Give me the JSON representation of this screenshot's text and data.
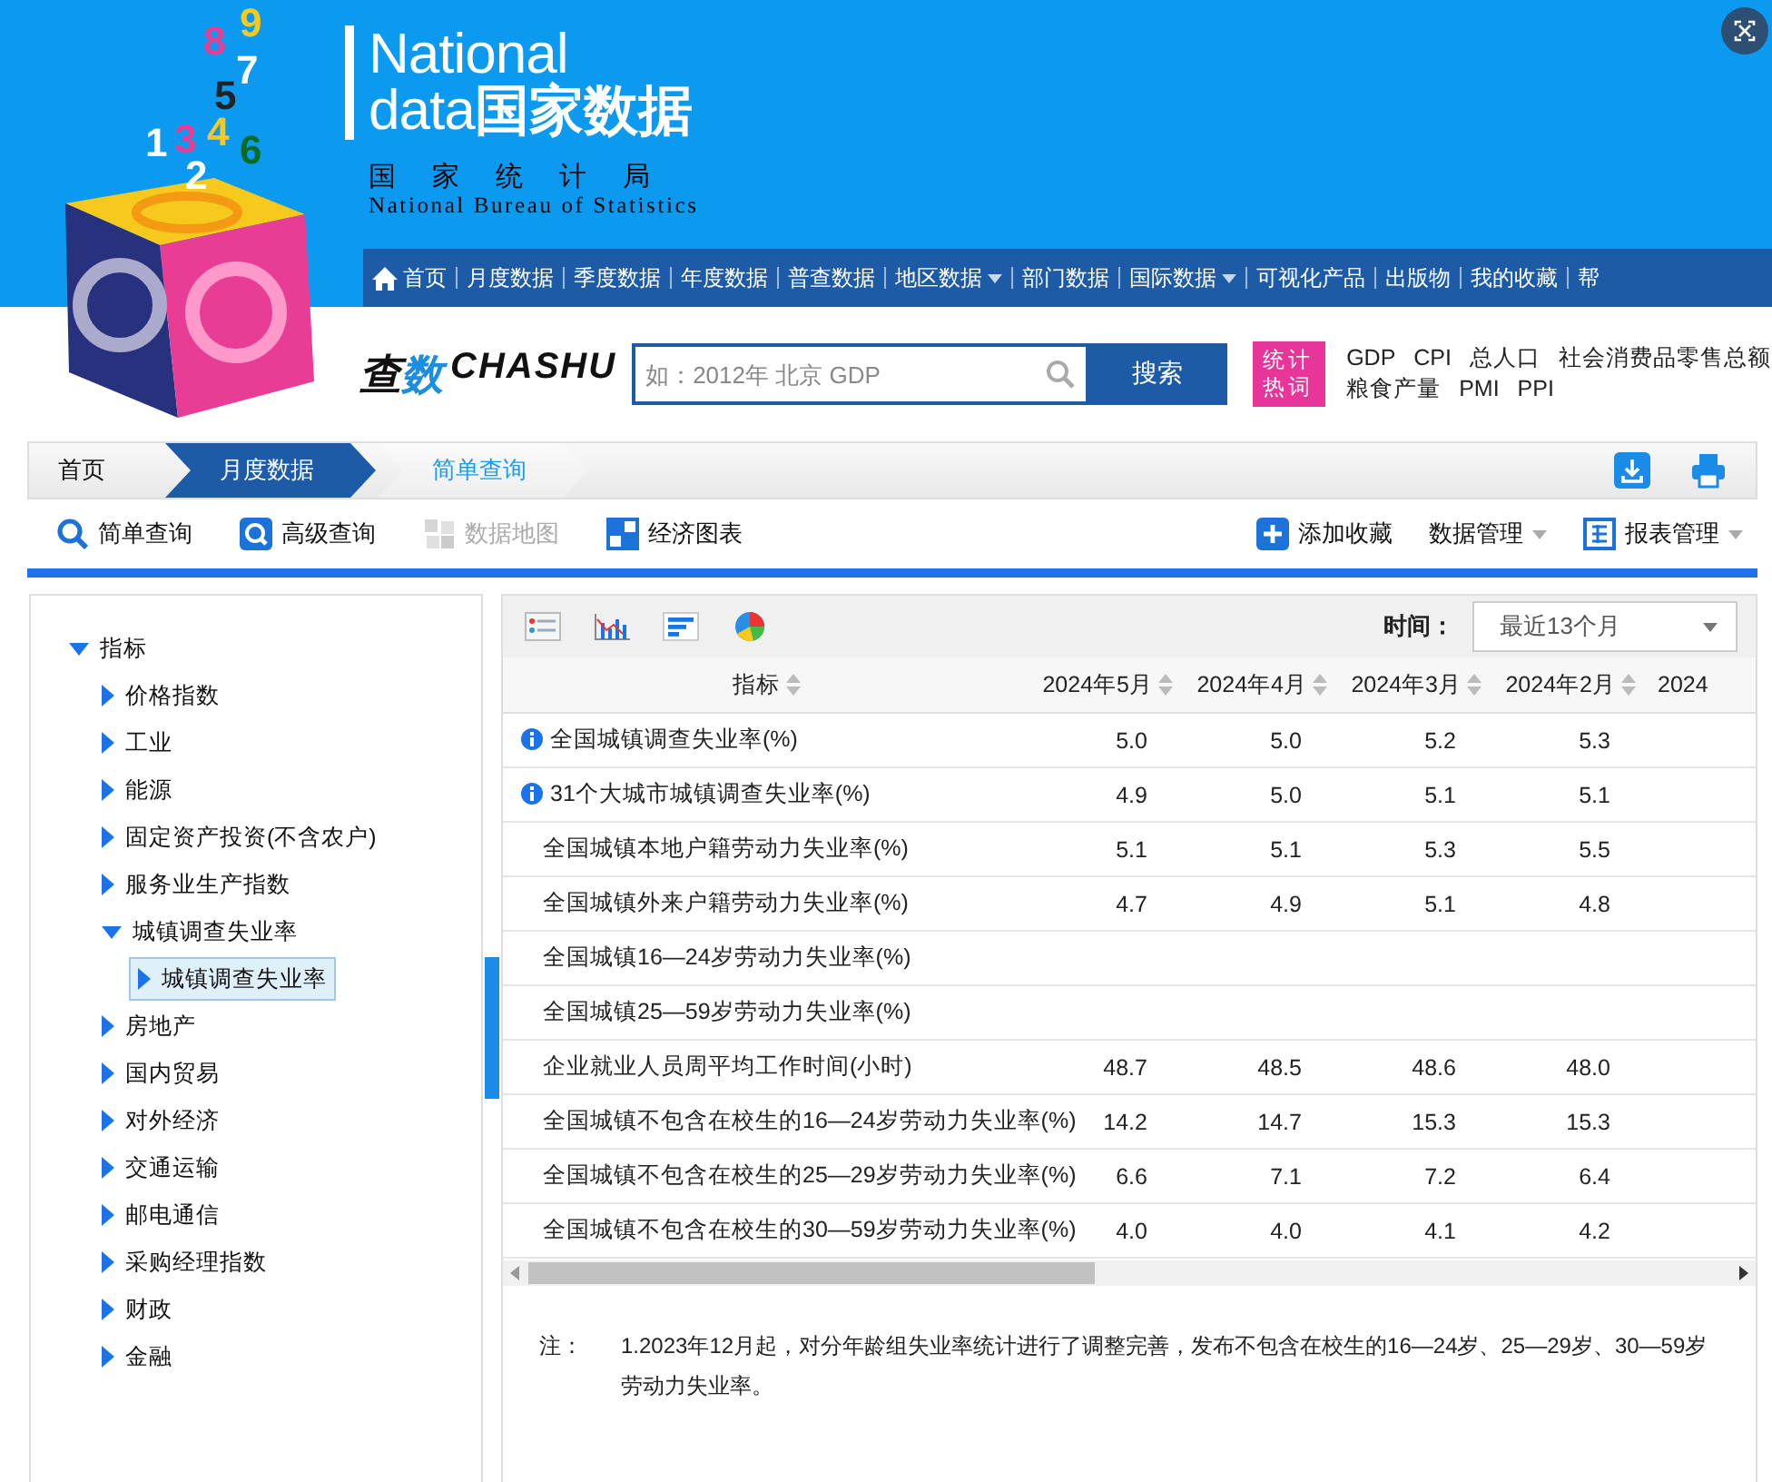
{
  "logo": {
    "digits": [
      "9",
      "8",
      "7",
      "5",
      "1",
      "3",
      "4",
      "6",
      "2"
    ]
  },
  "brand": {
    "line_1": "National",
    "line_2_en": "data",
    "line_2_cn": "国家数据",
    "bureau_cn": "国家统计局",
    "bureau_en": "National Bureau of Statistics"
  },
  "nav": [
    {
      "label": "首页",
      "kind": "home",
      "dropdown": false
    },
    {
      "label": "月度数据",
      "kind": "link",
      "dropdown": false
    },
    {
      "label": "季度数据",
      "kind": "link",
      "dropdown": false
    },
    {
      "label": "年度数据",
      "kind": "link",
      "dropdown": false
    },
    {
      "label": "普查数据",
      "kind": "link",
      "dropdown": false
    },
    {
      "label": "地区数据",
      "kind": "link",
      "dropdown": true
    },
    {
      "label": "部门数据",
      "kind": "link",
      "dropdown": false
    },
    {
      "label": "国际数据",
      "kind": "link",
      "dropdown": true
    },
    {
      "label": "可视化产品",
      "kind": "link",
      "dropdown": false
    },
    {
      "label": "出版物",
      "kind": "link",
      "dropdown": false
    },
    {
      "label": "我的收藏",
      "kind": "link",
      "dropdown": false
    },
    {
      "label": "帮",
      "kind": "link",
      "dropdown": false
    }
  ],
  "search": {
    "logo": [
      "查",
      "数",
      "CHASHU"
    ],
    "placeholder": "如：2012年 北京 GDP",
    "button": "搜索",
    "hot_label": "统计热词",
    "hot_words": [
      "GDP",
      "CPI",
      "总人口",
      "社会消费品零售总额",
      "粮食产量",
      "PMI",
      "PPI"
    ]
  },
  "breadcrumb": [
    {
      "label": "首页",
      "kind": "home"
    },
    {
      "label": "月度数据",
      "kind": "section"
    },
    {
      "label": "简单查询",
      "kind": "current"
    }
  ],
  "tools": [
    {
      "label": "简单查询",
      "disabled": false
    },
    {
      "label": "高级查询",
      "disabled": false
    },
    {
      "label": "数据地图",
      "disabled": true
    },
    {
      "label": "经济图表",
      "disabled": false
    }
  ],
  "tools_right": [
    {
      "label": "添加收藏",
      "dropdown": false
    },
    {
      "label": "数据管理",
      "dropdown": true
    },
    {
      "label": "报表管理",
      "dropdown": true
    }
  ],
  "tree": {
    "label": "指标",
    "expanded": true,
    "selected": false,
    "children": [
      {
        "label": "价格指数",
        "expanded": false,
        "selected": false
      },
      {
        "label": "工业",
        "expanded": false,
        "selected": false
      },
      {
        "label": "能源",
        "expanded": false,
        "selected": false
      },
      {
        "label": "固定资产投资(不含农户)",
        "expanded": false,
        "selected": false
      },
      {
        "label": "服务业生产指数",
        "expanded": false,
        "selected": false
      },
      {
        "label": "城镇调查失业率",
        "expanded": true,
        "selected": false,
        "children": [
          {
            "label": "城镇调查失业率",
            "expanded": false,
            "selected": true
          }
        ]
      },
      {
        "label": "房地产",
        "expanded": false,
        "selected": false
      },
      {
        "label": "国内贸易",
        "expanded": false,
        "selected": false
      },
      {
        "label": "对外经济",
        "expanded": false,
        "selected": false
      },
      {
        "label": "交通运输",
        "expanded": false,
        "selected": false
      },
      {
        "label": "邮电通信",
        "expanded": false,
        "selected": false
      },
      {
        "label": "采购经理指数",
        "expanded": false,
        "selected": false
      },
      {
        "label": "财政",
        "expanded": false,
        "selected": false
      },
      {
        "label": "金融",
        "expanded": false,
        "selected": false
      }
    ]
  },
  "view_modes": [
    {
      "kind": "table",
      "selected": false
    },
    {
      "kind": "bar",
      "selected": false
    },
    {
      "kind": "hbar",
      "selected": false
    },
    {
      "kind": "pie",
      "selected": false
    }
  ],
  "time_filter": {
    "label": "时间：",
    "value": "最近13个月"
  },
  "table": {
    "columns": [
      "指标",
      "2024年5月",
      "2024年4月",
      "2024年3月",
      "2024年2月",
      "2024"
    ],
    "rows": [
      {
        "name": "全国城镇调查失业率(%)",
        "info": true,
        "values": [
          "5.0",
          "5.0",
          "5.2",
          "5.3"
        ]
      },
      {
        "name": "31个大城市城镇调查失业率(%)",
        "info": true,
        "values": [
          "4.9",
          "5.0",
          "5.1",
          "5.1"
        ]
      },
      {
        "name": "全国城镇本地户籍劳动力失业率(%)",
        "info": false,
        "values": [
          "5.1",
          "5.1",
          "5.3",
          "5.5"
        ]
      },
      {
        "name": "全国城镇外来户籍劳动力失业率(%)",
        "info": false,
        "values": [
          "4.7",
          "4.9",
          "5.1",
          "4.8"
        ]
      },
      {
        "name": "全国城镇16—24岁劳动力失业率(%)",
        "info": false,
        "values": []
      },
      {
        "name": "全国城镇25—59岁劳动力失业率(%)",
        "info": false,
        "values": []
      },
      {
        "name": "企业就业人员周平均工作时间(小时)",
        "info": false,
        "values": [
          "48.7",
          "48.5",
          "48.6",
          "48.0"
        ]
      },
      {
        "name": "全国城镇不包含在校生的16—24岁劳动力失业率(%)",
        "info": false,
        "values": [
          "14.2",
          "14.7",
          "15.3",
          "15.3"
        ]
      },
      {
        "name": "全国城镇不包含在校生的25—29岁劳动力失业率(%)",
        "info": false,
        "values": [
          "6.6",
          "7.1",
          "7.2",
          "6.4"
        ]
      },
      {
        "name": "全国城镇不包含在校生的30—59岁劳动力失业率(%)",
        "info": false,
        "values": [
          "4.0",
          "4.0",
          "4.1",
          "4.2"
        ]
      }
    ]
  },
  "note": {
    "label": "注：",
    "text": "1.2023年12月起，对分年龄组失业率统计进行了调整完善，发布不包含在校生的16—24岁、25—29岁、30—59岁劳动力失业率。"
  }
}
